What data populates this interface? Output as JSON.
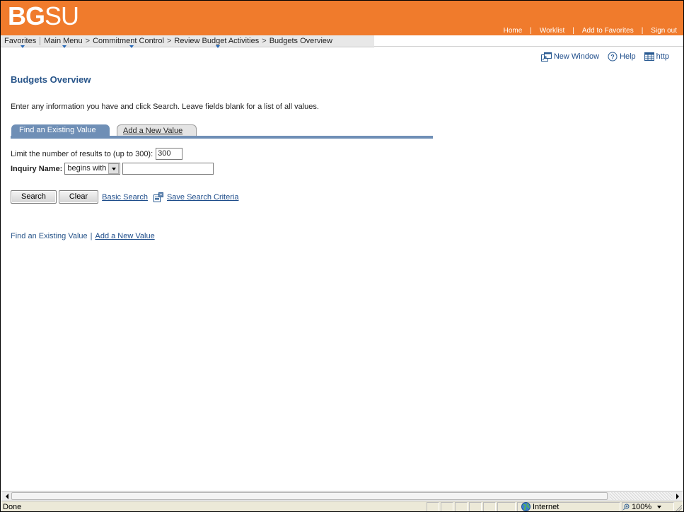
{
  "header": {
    "logo_bold": "BG",
    "logo_light": "SU",
    "links": [
      "Home",
      "Worklist",
      "Add to Favorites",
      "Sign out"
    ]
  },
  "menu": {
    "favorites": "Favorites",
    "main_menu": "Main Menu",
    "breadcrumb": [
      "Commitment Control",
      "Review Budget Activities",
      "Budgets Overview"
    ],
    "separator": ">"
  },
  "utility": {
    "new_window": "New Window",
    "help": "Help",
    "http": "http"
  },
  "page": {
    "title": "Budgets Overview",
    "instructions": "Enter any information you have and click Search. Leave fields blank for a list of all values."
  },
  "tabs": {
    "active": "Find an Existing Value",
    "inactive": "Add a New Value"
  },
  "form": {
    "limit_label": "Limit the number of results to (up to 300):",
    "limit_value": "300",
    "inquiry_label": "Inquiry Name:",
    "operator_value": "begins with",
    "inquiry_value": ""
  },
  "actions": {
    "search": "Search",
    "clear": "Clear",
    "basic_search": "Basic Search",
    "save_search": "Save Search Criteria"
  },
  "bottom_links": {
    "find": "Find an Existing Value",
    "add": "Add a New Value"
  },
  "statusbar": {
    "status_text": "Done",
    "zone": "Internet",
    "zoom": "100%"
  },
  "colors": {
    "header_bg": "#f07b2c",
    "title_blue": "#28558a",
    "link_blue": "#1d4c8a",
    "tab_blue": "#6f8fb6"
  }
}
